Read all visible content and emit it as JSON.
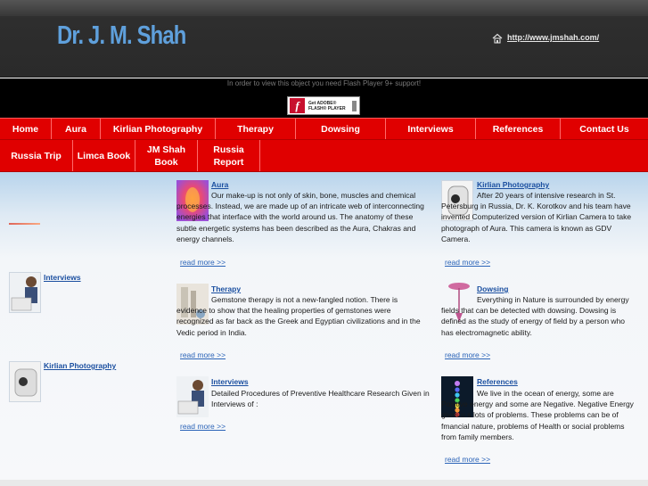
{
  "site": {
    "logo": "Dr. J. M. Shah",
    "header_link": "http://www.jmshah.com/"
  },
  "flash": {
    "message": "In order to view this object you need Flash Player 9+ support!",
    "badge_line1": "Get ADOBE®",
    "badge_line2": "FLASH® PLAYER"
  },
  "nav": {
    "row1": [
      "Home",
      "Aura",
      "Kirlian Photography",
      "Therapy",
      "Dowsing",
      "Interviews",
      "References",
      "Contact Us"
    ],
    "row2": [
      "Russia Trip",
      "Limca Book",
      "JM Shah Book",
      "Russia Report"
    ]
  },
  "sidebar": [
    {
      "title": "Interviews"
    },
    {
      "title": "Kirlian Photography"
    }
  ],
  "articles": [
    {
      "title": "Aura",
      "text": "Our make-up is not only of skin, bone, muscles and chemical processes. Instead, we are made up of an intricate web of interconnecting energies that interface with the world around us. The anatomy of these subtle energetic systems has been described as the Aura, Chakras and energy channels.",
      "more": "read more >>"
    },
    {
      "title": "Kirlian Photography",
      "text": "After 20 years of intensive research in St. Petersburg in Russia, Dr. K. Korotkov and his team have invented Computerized version of Kirlian Camera to take photograph of Aura. This camera is known as GDV Camera.",
      "more": "read more >>"
    },
    {
      "title": "Therapy",
      "text": "Gemstone therapy is not a new-fangled notion. There is evidence to show that the healing properties of gemstones were recognized as far back as the Greek and Egyptian civilizations and in the Vedic period in India.",
      "more": "read more >>"
    },
    {
      "title": "Dowsing",
      "text": "Everything in Nature is surrounded by energy fields that can be detected with dowsing. Dowsing is defined as the study of energy of field by a person who has electromagnetic ability.",
      "more": "read more >>"
    },
    {
      "title": "Interviews",
      "text": "Detailed Procedures of Preventive Healthcare Research Given in Interviews of :",
      "more": "read more >>"
    },
    {
      "title": "References",
      "text": "We live in the ocean of energy, some are Positive energy and some are Negative. Negative Energy gives u s lots of problems. These problems can be of fmancial nature, problems of Health or social problems from family members.",
      "more": "read more >>"
    }
  ],
  "colors": {
    "nav_red": "#e00000",
    "link_blue": "#1b4fa0",
    "header_bg": "#2e2e2e",
    "logo_blue": "#5fa0dc"
  },
  "icons": [
    "home-icon",
    "flash-player-icon"
  ]
}
